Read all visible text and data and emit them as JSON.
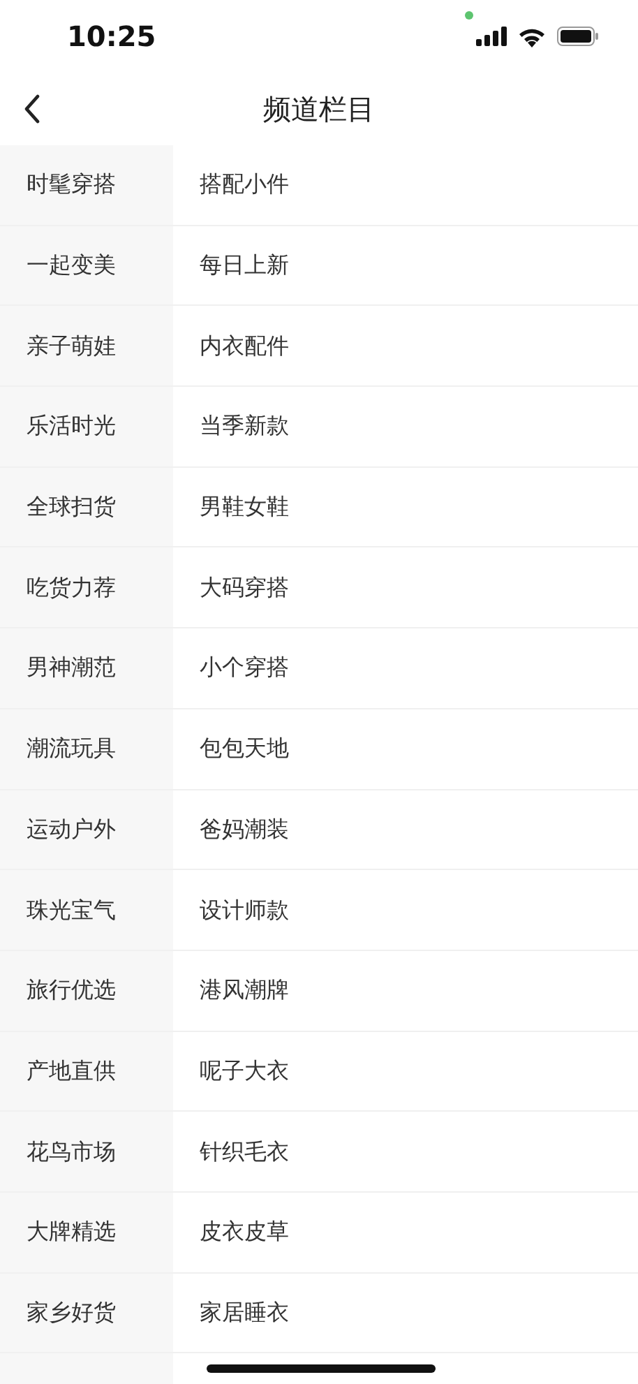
{
  "status_bar": {
    "time": "10:25"
  },
  "nav": {
    "title": "频道栏目"
  },
  "rows": [
    {
      "category": "时髦穿搭",
      "channel": "搭配小件"
    },
    {
      "category": "一起变美",
      "channel": "每日上新"
    },
    {
      "category": "亲子萌娃",
      "channel": "内衣配件"
    },
    {
      "category": "乐活时光",
      "channel": "当季新款"
    },
    {
      "category": "全球扫货",
      "channel": "男鞋女鞋"
    },
    {
      "category": "吃货力荐",
      "channel": "大码穿搭"
    },
    {
      "category": "男神潮范",
      "channel": "小个穿搭"
    },
    {
      "category": "潮流玩具",
      "channel": "包包天地"
    },
    {
      "category": "运动户外",
      "channel": "爸妈潮装"
    },
    {
      "category": "珠光宝气",
      "channel": "设计师款"
    },
    {
      "category": "旅行优选",
      "channel": "港风潮牌"
    },
    {
      "category": "产地直供",
      "channel": "呢子大衣"
    },
    {
      "category": "花鸟市场",
      "channel": "针织毛衣"
    },
    {
      "category": "大牌精选",
      "channel": "皮衣皮草"
    },
    {
      "category": "家乡好货",
      "channel": "家居睡衣"
    }
  ]
}
